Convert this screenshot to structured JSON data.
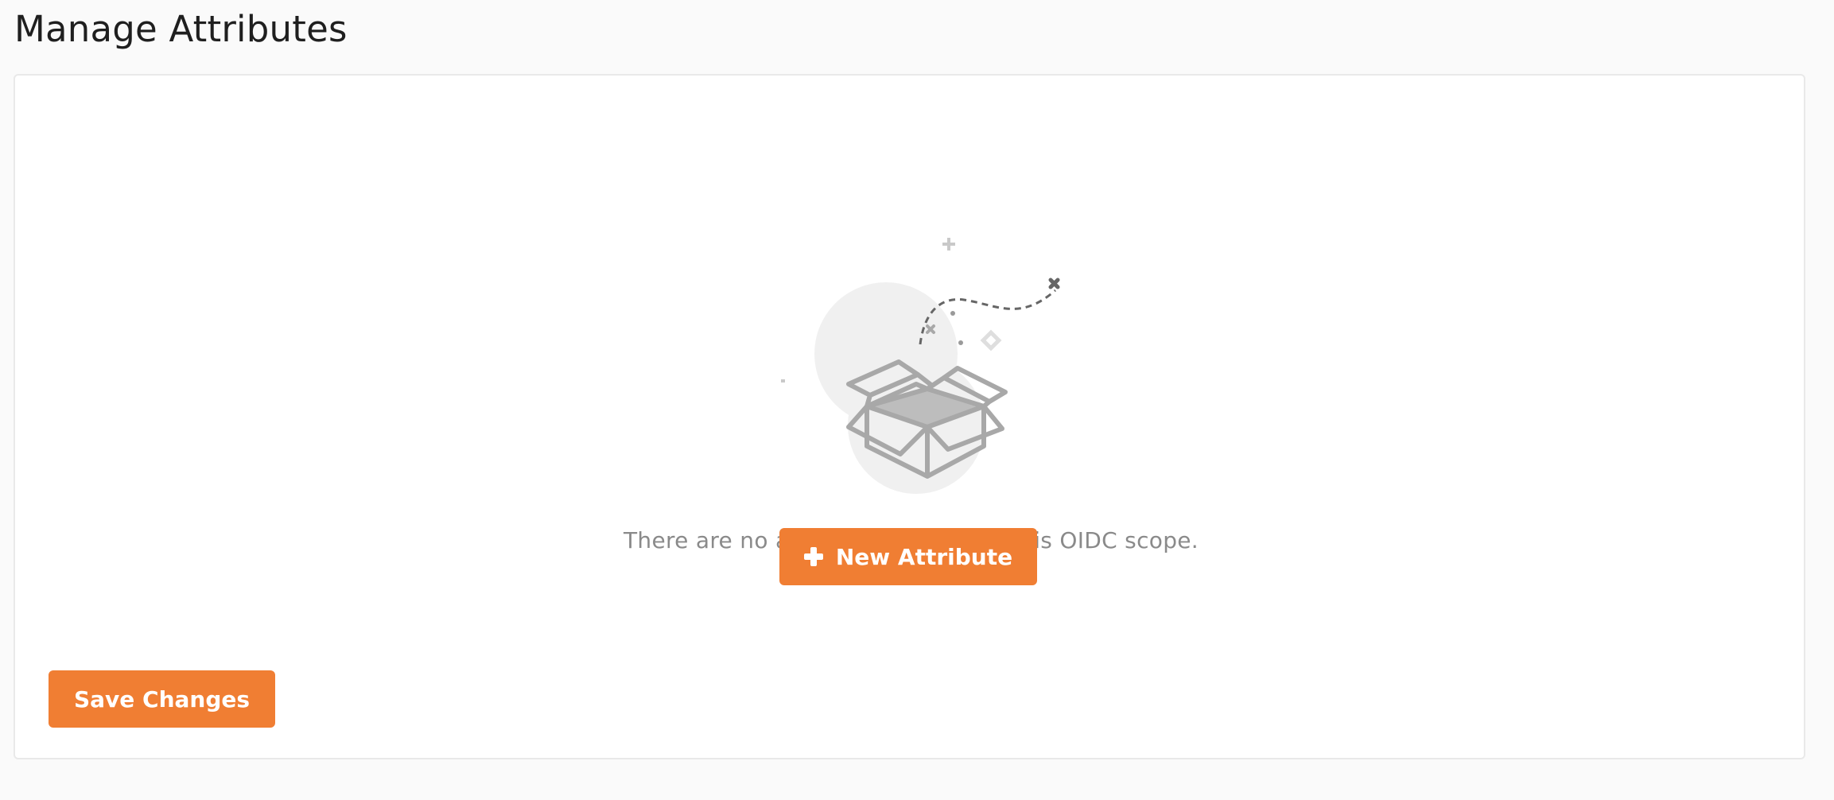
{
  "page": {
    "title": "Manage Attributes"
  },
  "empty_state": {
    "message": "There are no attributes added for this OIDC scope.",
    "illustration": "open-empty-box-icon"
  },
  "actions": {
    "new_attribute_label": "New Attribute",
    "new_attribute_icon": "plus-icon",
    "save_label": "Save Changes"
  },
  "colors": {
    "accent": "#f07e33",
    "background": "#fafafa",
    "panel": "#ffffff",
    "muted_text": "#8a8a8a",
    "title_text": "#1f1f1f"
  }
}
